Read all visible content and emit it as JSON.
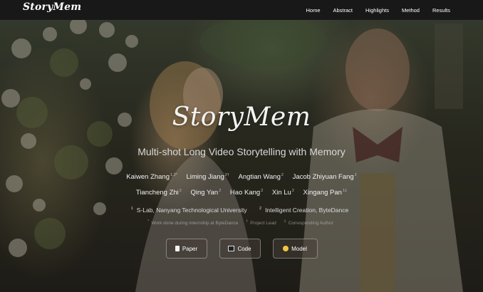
{
  "nav": {
    "brand": "StoryMem",
    "links": [
      "Home",
      "Abstract",
      "Highlights",
      "Method",
      "Results"
    ]
  },
  "hero": {
    "title": "StoryMem",
    "subtitle": "Multi-shot Long Video Storytelling with Memory",
    "authors_row1": [
      {
        "name": "Kaiwen Zhang",
        "sup": "1,2*"
      },
      {
        "name": "Liming Jiang",
        "sup": "2†"
      },
      {
        "name": "Angtian Wang",
        "sup": "2"
      },
      {
        "name": "Jacob Zhiyuan Fang",
        "sup": "2"
      }
    ],
    "authors_row2": [
      {
        "name": "Tiancheng Zhi",
        "sup": "2"
      },
      {
        "name": "Qing Yan",
        "sup": "2"
      },
      {
        "name": "Hao Kang",
        "sup": "2"
      },
      {
        "name": "Xin Lu",
        "sup": "2"
      },
      {
        "name": "Xingang Pan",
        "sup": "1‡"
      }
    ],
    "affiliations": [
      {
        "sup": "1",
        "text": "S-Lab, Nanyang Technological University"
      },
      {
        "sup": "2",
        "text": "Intelligent Creation, ByteDance"
      }
    ],
    "notes": [
      {
        "sup": "*",
        "text": "Work done during internship at ByteDance"
      },
      {
        "sup": "†",
        "text": "Project Lead"
      },
      {
        "sup": "‡",
        "text": "Corresponding Author"
      }
    ]
  },
  "buttons": {
    "paper": "Paper",
    "code": "Code",
    "model": "Model"
  },
  "icons": {
    "paper": "document-icon",
    "code": "terminal-icon",
    "model": "hugging-face-icon"
  },
  "colors": {
    "navbar": "#181818",
    "text": "#ffffff",
    "button_bg": "#463c37"
  }
}
